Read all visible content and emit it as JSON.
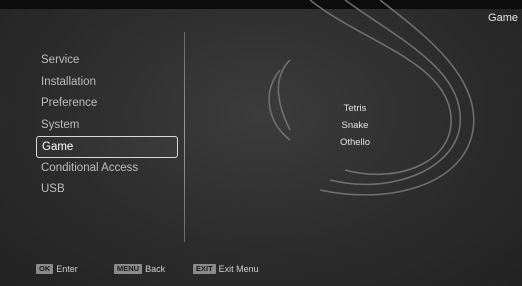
{
  "header": {
    "title": "Game"
  },
  "menu": {
    "items": [
      {
        "label": "Service"
      },
      {
        "label": "Installation"
      },
      {
        "label": "Preference"
      },
      {
        "label": "System"
      },
      {
        "label": "Game"
      },
      {
        "label": "Conditional Access"
      },
      {
        "label": "USB"
      }
    ],
    "selected_index": 4
  },
  "games": {
    "items": [
      {
        "label": "Tetris"
      },
      {
        "label": "Snake"
      },
      {
        "label": "Othello"
      }
    ]
  },
  "footer": {
    "hints": [
      {
        "key": "OK",
        "label": "Enter",
        "icon": "ok-key-icon"
      },
      {
        "key": "MENU",
        "label": "Back",
        "icon": "menu-key-icon"
      },
      {
        "key": "EXIT",
        "label": "Exit Menu",
        "icon": "exit-key-icon"
      }
    ]
  },
  "colors": {
    "background": "#2c2c2c",
    "text": "#d8d8d8",
    "selection_border": "#d8d8d8",
    "key_badge": "#8a8a8a"
  }
}
